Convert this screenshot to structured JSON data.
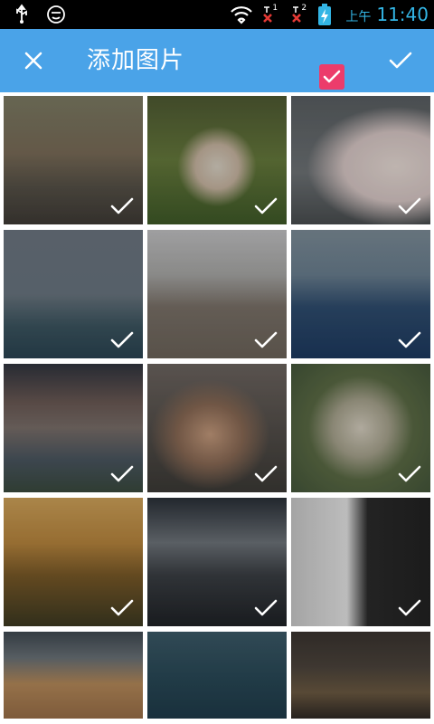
{
  "status_bar": {
    "ampm": "上午",
    "time": "11:40",
    "signal_label_1": "1",
    "signal_label_2": "2",
    "icons": [
      "usb-icon",
      "emoji-icon",
      "wifi-icon",
      "signal-icon",
      "signal-icon",
      "battery-charging-icon"
    ]
  },
  "toolbar": {
    "title": "添加图片",
    "close_icon": "close-icon",
    "confirm_icon": "check-icon",
    "select_all_checked": true
  },
  "colors": {
    "toolbar_bg": "#4aa3e8",
    "select_accent": "#ec3c6b",
    "time_color": "#33b5e5"
  },
  "photos": [
    {
      "selected": true
    },
    {
      "selected": true
    },
    {
      "selected": true
    },
    {
      "selected": true
    },
    {
      "selected": true
    },
    {
      "selected": true
    },
    {
      "selected": true
    },
    {
      "selected": true
    },
    {
      "selected": true
    },
    {
      "selected": true
    },
    {
      "selected": true
    },
    {
      "selected": true
    },
    {
      "selected": false
    },
    {
      "selected": false
    },
    {
      "selected": false
    }
  ]
}
